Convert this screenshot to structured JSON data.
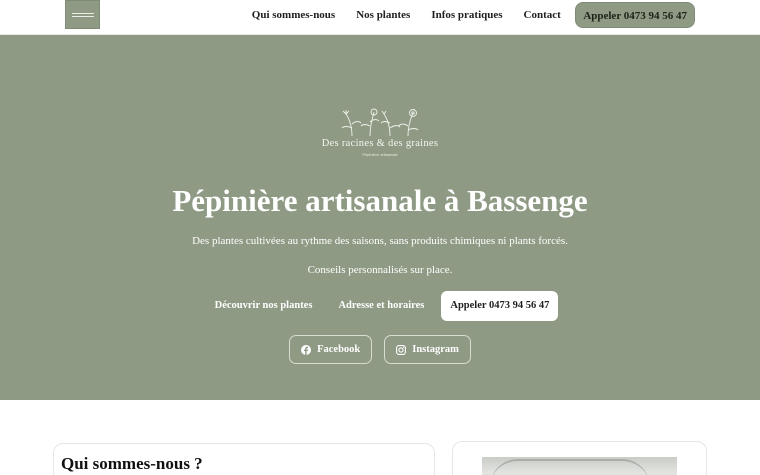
{
  "header": {
    "nav": [
      {
        "label": "Qui sommes-nous"
      },
      {
        "label": "Nos plantes"
      },
      {
        "label": "Infos pratiques"
      },
      {
        "label": "Contact"
      }
    ],
    "call_label": "Appeler 0473 94 56 47"
  },
  "hero": {
    "brand_name": "Des racines & des graines",
    "brand_tagline": "Pépinière artisanale",
    "title": "Pépinière artisanale à Bassenge",
    "subtitle_1": "Des plantes cultivées au rythme des saisons, sans produits chimiques ni plants forcés.",
    "subtitle_2": "Conseils personnalisés sur place.",
    "ctas": {
      "plants": "Découvrir nos plantes",
      "hours": "Adresse et horaires",
      "call": "Appeler 0473 94 56 47"
    },
    "social": {
      "facebook": "Facebook",
      "instagram": "Instagram"
    }
  },
  "about": {
    "heading": "Qui sommes-nous ?"
  },
  "colors": {
    "sage": "#8e9a84",
    "white": "#ffffff",
    "text": "#1f1f1f"
  },
  "icons": {
    "facebook": "facebook-icon",
    "instagram": "instagram-icon",
    "logo": "botanical-logo"
  }
}
